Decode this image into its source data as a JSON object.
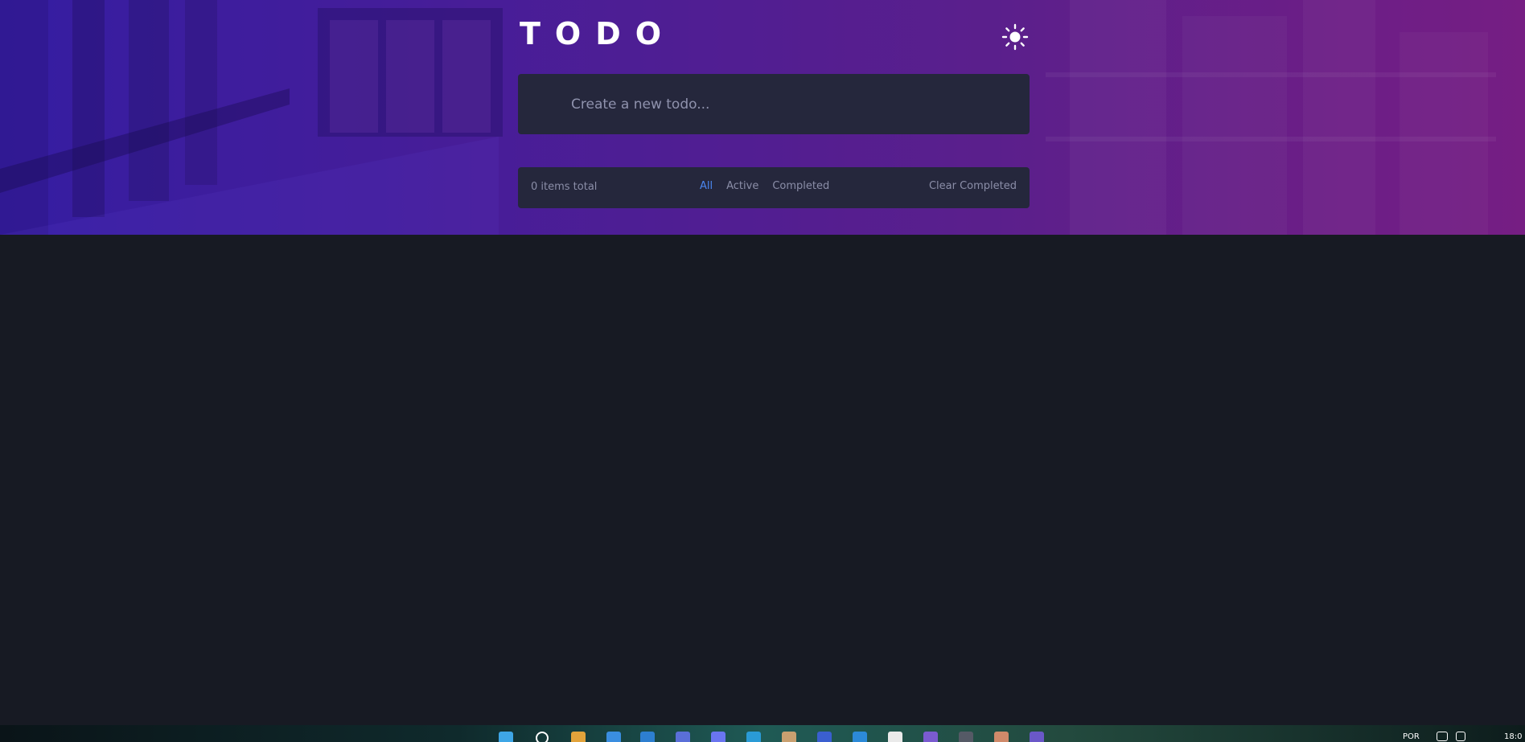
{
  "app": {
    "title": "TODO",
    "theme_toggle_icon": "sun-icon"
  },
  "new_todo": {
    "placeholder": "Create a new todo..."
  },
  "footer": {
    "count_text": "0 items total",
    "filters": [
      {
        "label": "All",
        "active": true
      },
      {
        "label": "Active",
        "active": false
      },
      {
        "label": "Completed",
        "active": false
      }
    ],
    "clear_label": "Clear Completed"
  },
  "taskbar": {
    "language": "POR",
    "clock": "18:0"
  },
  "colors": {
    "page_background": "#171a23",
    "card_background": "#25273c",
    "active_filter": "#4b87f0",
    "muted_text": "#8b8ea8",
    "gradient_start": "#3c22b8",
    "gradient_end": "#8b2393"
  }
}
